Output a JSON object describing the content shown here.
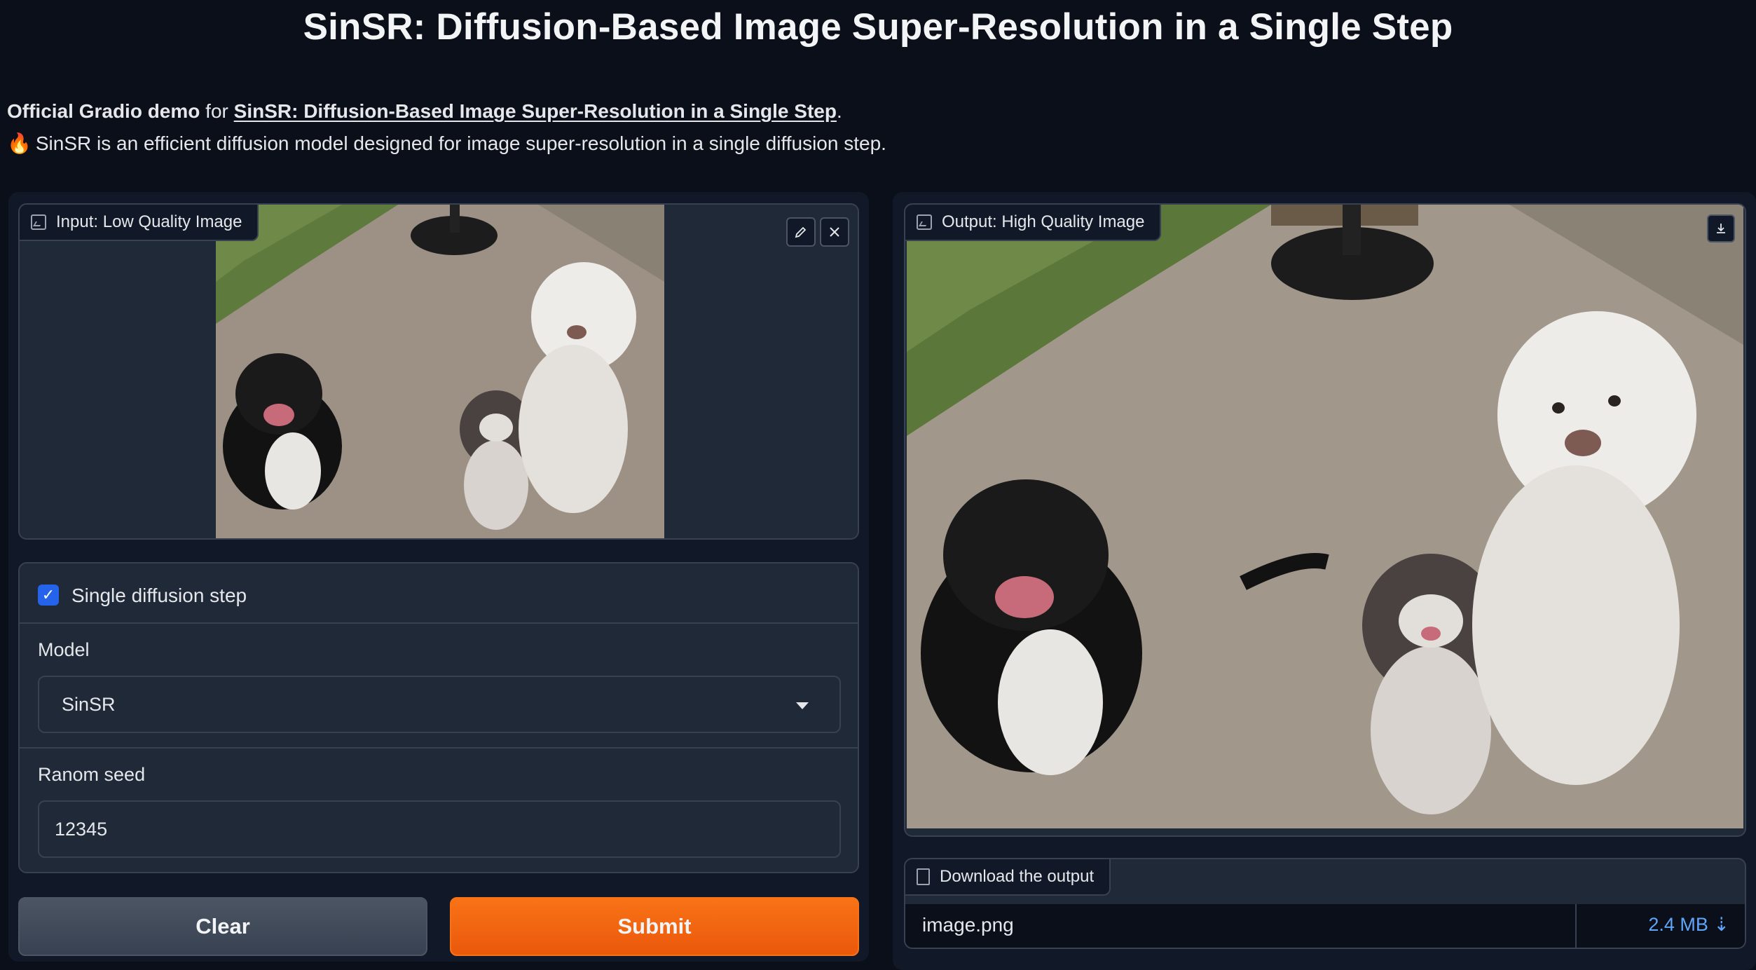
{
  "header": {
    "title": "SinSR: Diffusion-Based Image Super-Resolution in a Single Step",
    "desc_bold": "Official Gradio demo",
    "desc_for": "for",
    "desc_link": "SinSR: Diffusion-Based Image Super-Resolution in a Single Step",
    "desc_period": ".",
    "desc_emoji": "🔥",
    "desc_line2": "SinSR is an efficient diffusion model designed for image super-resolution in a single diffusion step."
  },
  "input_image": {
    "label": "Input: Low Quality Image",
    "edit_icon": "pencil-icon",
    "clear_icon": "close-icon"
  },
  "output_image": {
    "label": "Output: High Quality Image",
    "download_icon": "download-icon"
  },
  "options": {
    "single_step_label": "Single diffusion step",
    "single_step_checked": true,
    "model_label": "Model",
    "model_value": "SinSR",
    "seed_label": "Ranom seed",
    "seed_value": "12345"
  },
  "buttons": {
    "clear": "Clear",
    "submit": "Submit"
  },
  "download": {
    "label": "Download the output",
    "file_name": "image.png",
    "file_size": "2.4 MB ⇣"
  },
  "colors": {
    "background": "#0b0f19",
    "panel": "#1f2937",
    "accent_orange": "#f97316",
    "checkbox_blue": "#2563eb",
    "link_blue": "#60a5fa"
  }
}
